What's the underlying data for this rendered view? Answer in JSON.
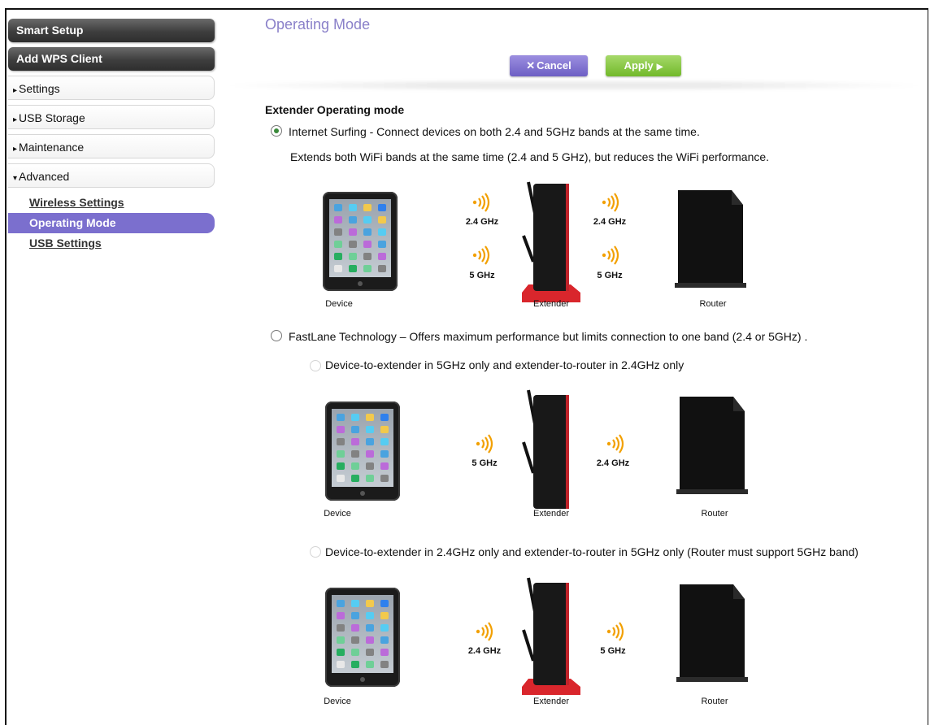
{
  "sidebar": {
    "buttons": [
      {
        "label": "Smart Setup"
      },
      {
        "label": "Add WPS Client"
      }
    ],
    "items": [
      {
        "label": "Settings",
        "caret": "▸"
      },
      {
        "label": "USB Storage",
        "caret": "▸"
      },
      {
        "label": "Maintenance",
        "caret": "▸"
      },
      {
        "label": "Advanced",
        "caret": "▾"
      }
    ],
    "subitems": [
      {
        "label": "Wireless Settings",
        "active": false
      },
      {
        "label": "Operating Mode",
        "active": true
      },
      {
        "label": "USB Settings",
        "active": false
      }
    ]
  },
  "page": {
    "title": "Operating Mode",
    "cancel_label": "Cancel",
    "cancel_icon": "close-icon",
    "apply_label": "Apply",
    "apply_icon": "play-arrow-icon",
    "section_title": "Extender Operating mode"
  },
  "modes": {
    "internet_surfing": {
      "label": "Internet Surfing - Connect devices on both 2.4 and 5GHz bands at the same time.",
      "description": "Extends both WiFi bands at the same time (2.4 and 5 GHz), but reduces the WiFi performance.",
      "selected": true
    },
    "fastlane": {
      "label": "FastLane Technology – Offers maximum performance but limits connection to one band (2.4 or 5GHz) .",
      "selected": false,
      "options": [
        {
          "label": "Device-to-extender in 5GHz only and extender-to-router in 2.4GHz only",
          "selected": false
        },
        {
          "label": "Device-to-extender in 2.4GHz only and extender-to-router in 5GHz only (Router must support 5GHz band)",
          "selected": false
        }
      ]
    }
  },
  "diagrams": [
    {
      "left_bands": [
        "2.4 GHz",
        "5 GHz"
      ],
      "right_bands": [
        "2.4 GHz",
        "5 GHz"
      ],
      "device": "Device",
      "extender": "Extender",
      "router": "Router"
    },
    {
      "left_bands": [
        "5 GHz"
      ],
      "right_bands": [
        "2.4 GHz"
      ],
      "device": "Device",
      "extender": "Extender",
      "router": "Router"
    },
    {
      "left_bands": [
        "2.4 GHz"
      ],
      "right_bands": [
        "5 GHz"
      ],
      "device": "Device",
      "extender": "Extender",
      "router": "Router"
    }
  ],
  "colors": {
    "accent_purple": "#7b6fce",
    "apply_green": "#7cc13a",
    "wifi_orange": "#f2a000",
    "extender_red": "#d9262c"
  }
}
